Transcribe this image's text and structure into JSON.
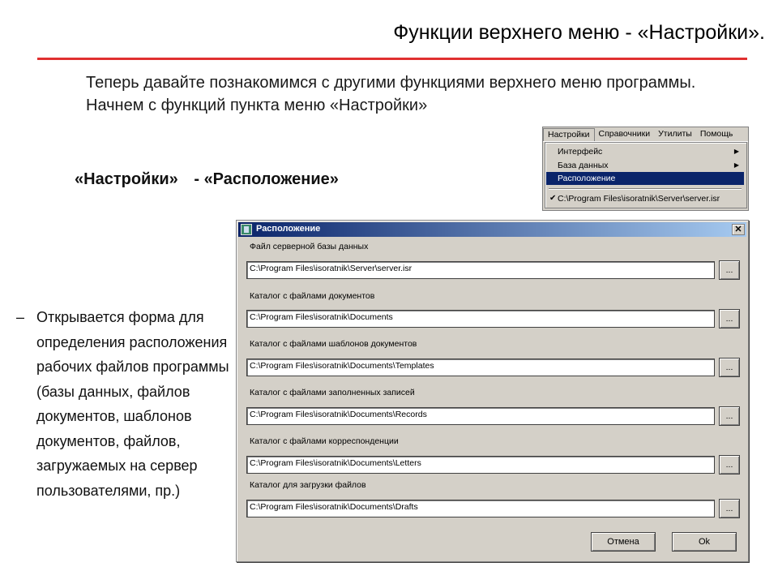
{
  "slide": {
    "title": "Функции верхнего меню - «Настройки».",
    "intro": "Теперь давайте познакомимся с другими функциями верхнего меню программы. Начнем с функций пункта меню «Настройки»",
    "heading_left": "«Настройки»",
    "heading_sep": "-",
    "heading_right": "«Расположение»",
    "bullet_dash": "–",
    "bullet_text": "Открывается форма для определения расположения рабочих файлов программы (базы данных, файлов документов, шаблонов документов, файлов, загружаемых на сервер пользователями, пр.)"
  },
  "menu": {
    "bar": [
      "Настройки",
      "Справочники",
      "Утилиты",
      "Помощь"
    ],
    "items": [
      {
        "label": "Интерфейс",
        "arrow": "▶"
      },
      {
        "label": "База данных",
        "arrow": "▶"
      },
      {
        "label": "Расположение",
        "arrow": ""
      }
    ],
    "recent_check": "✔",
    "recent": "C:\\Program Files\\isoratnik\\Server\\server.isr"
  },
  "dialog": {
    "title": "Расположение",
    "close": "✕",
    "fields": [
      {
        "label": "Файл  серверной базы данных",
        "value": "C:\\Program Files\\isoratnik\\Server\\server.isr"
      },
      {
        "label": "Каталог с файлами документов",
        "value": "C:\\Program Files\\isoratnik\\Documents"
      },
      {
        "label": "Каталог с файлами шаблонов документов",
        "value": "C:\\Program Files\\isoratnik\\Documents\\Templates"
      },
      {
        "label": "Каталог с файлами заполненных записей",
        "value": "C:\\Program Files\\isoratnik\\Documents\\Records"
      },
      {
        "label": "Каталог с файлами корреспонденции",
        "value": "C:\\Program Files\\isoratnik\\Documents\\Letters"
      },
      {
        "label": "Каталог для загрузки файлов",
        "value": "C:\\Program Files\\isoratnik\\Documents\\Drafts"
      }
    ],
    "browse": "...",
    "cancel": "Отмена",
    "ok": "Ok"
  }
}
